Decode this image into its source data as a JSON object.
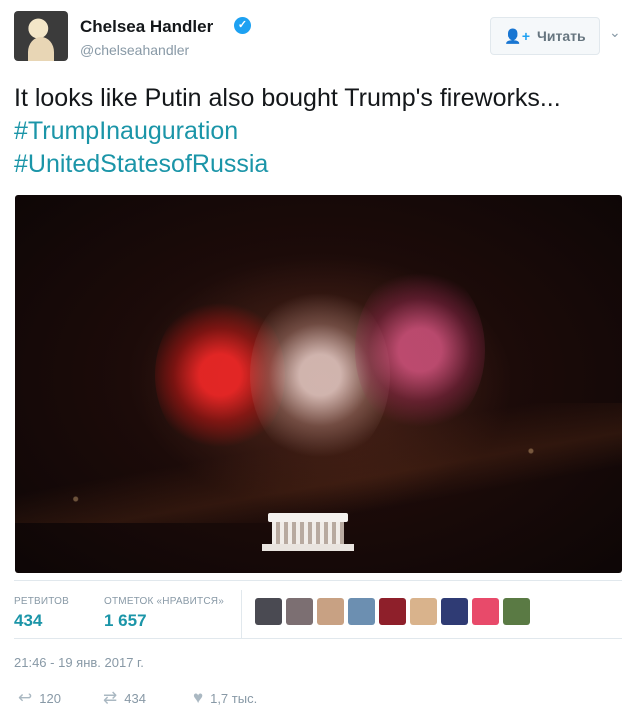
{
  "author": {
    "name": "Chelsea Handler",
    "handle": "@chelseahandler",
    "verified_icon": "check-icon"
  },
  "follow_button": {
    "label": "Читать",
    "icon": "add-person-icon"
  },
  "menu_caret": "chevron-down-icon",
  "tweet": {
    "text_part1": "It looks like Putin also bought Trump's fireworks...",
    "hashtag1": "#TrumpInauguration",
    "hashtag2": "#UnitedStatesofRussia"
  },
  "media": {
    "description_icon": "video-frame",
    "colors": [
      "#ff2a2a",
      "#f0d7d2",
      "#e65a8c"
    ]
  },
  "stats": {
    "retweets_label": "РЕТВИТОВ",
    "retweets_value": "434",
    "likes_label": "ОТМЕТОК «НРАВИТСЯ»",
    "likes_value": "1 657"
  },
  "likers": [
    {
      "color": "#4a4a52"
    },
    {
      "color": "#7c6f72"
    },
    {
      "color": "#c8a183"
    },
    {
      "color": "#6c8fb1"
    },
    {
      "color": "#8e1f2a"
    },
    {
      "color": "#d9b38c"
    },
    {
      "color": "#2f3b74"
    },
    {
      "color": "#e84a6a"
    },
    {
      "color": "#5a7a44"
    }
  ],
  "timestamp": "21:46 - 19 янв. 2017 г.",
  "actions": {
    "reply_count": "120",
    "retweet_count": "434",
    "like_count": "1,7 тыс."
  }
}
